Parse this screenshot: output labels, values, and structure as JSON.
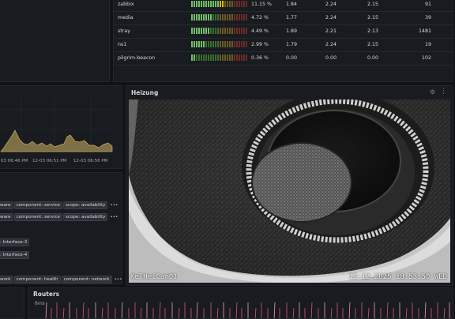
{
  "hosts": [
    {
      "name": "zabbix",
      "pct": "11.15 %",
      "a": "1.84",
      "b": "2.24",
      "c": "2.15",
      "d": "91",
      "level": 0.55
    },
    {
      "name": "media",
      "pct": "4.72 %",
      "a": "1.77",
      "b": "2.24",
      "c": "2.15",
      "d": "39",
      "level": 0.35
    },
    {
      "name": "stray",
      "pct": "4.49 %",
      "a": "1.89",
      "b": "2.21",
      "c": "2.13",
      "d": "1481",
      "level": 0.33
    },
    {
      "name": "ns1",
      "pct": "2.99 %",
      "a": "1.79",
      "b": "2.24",
      "c": "2.15",
      "d": "19",
      "level": 0.22
    },
    {
      "name": "pilgrim-beacon",
      "pct": "0.36 %",
      "a": "0.00",
      "b": "0.00",
      "c": "0.00",
      "d": "102",
      "level": 0.06
    }
  ],
  "timechart": {
    "xticks": [
      "03 06:46 PM",
      "12-03 06:51 PM",
      "12-03 06:56 PM"
    ],
    "fill": "#8a7a4a",
    "stroke": "#c9a95b"
  },
  "tags": {
    "row1": [
      "ware",
      "component: service",
      "scope: availability"
    ],
    "row2": [
      "ware",
      "component: service",
      "scope: availability"
    ],
    "row3": [
      ": Interface-3"
    ],
    "row4": [
      ": Interface-4"
    ],
    "row5": [
      "work",
      "component: health",
      "component: network"
    ],
    "more": "•••"
  },
  "camera": {
    "title": "Heizung",
    "osd_name": "KelHeiCam01",
    "osd_time": "12-12-2025 18:53:50 WED"
  },
  "routers": {
    "title": "Routers",
    "ylabel": "6ms"
  },
  "colors": {
    "bg": "#111217",
    "panel": "#181b1f",
    "accent": "#c9a95b",
    "router_line": "#e0596b"
  }
}
